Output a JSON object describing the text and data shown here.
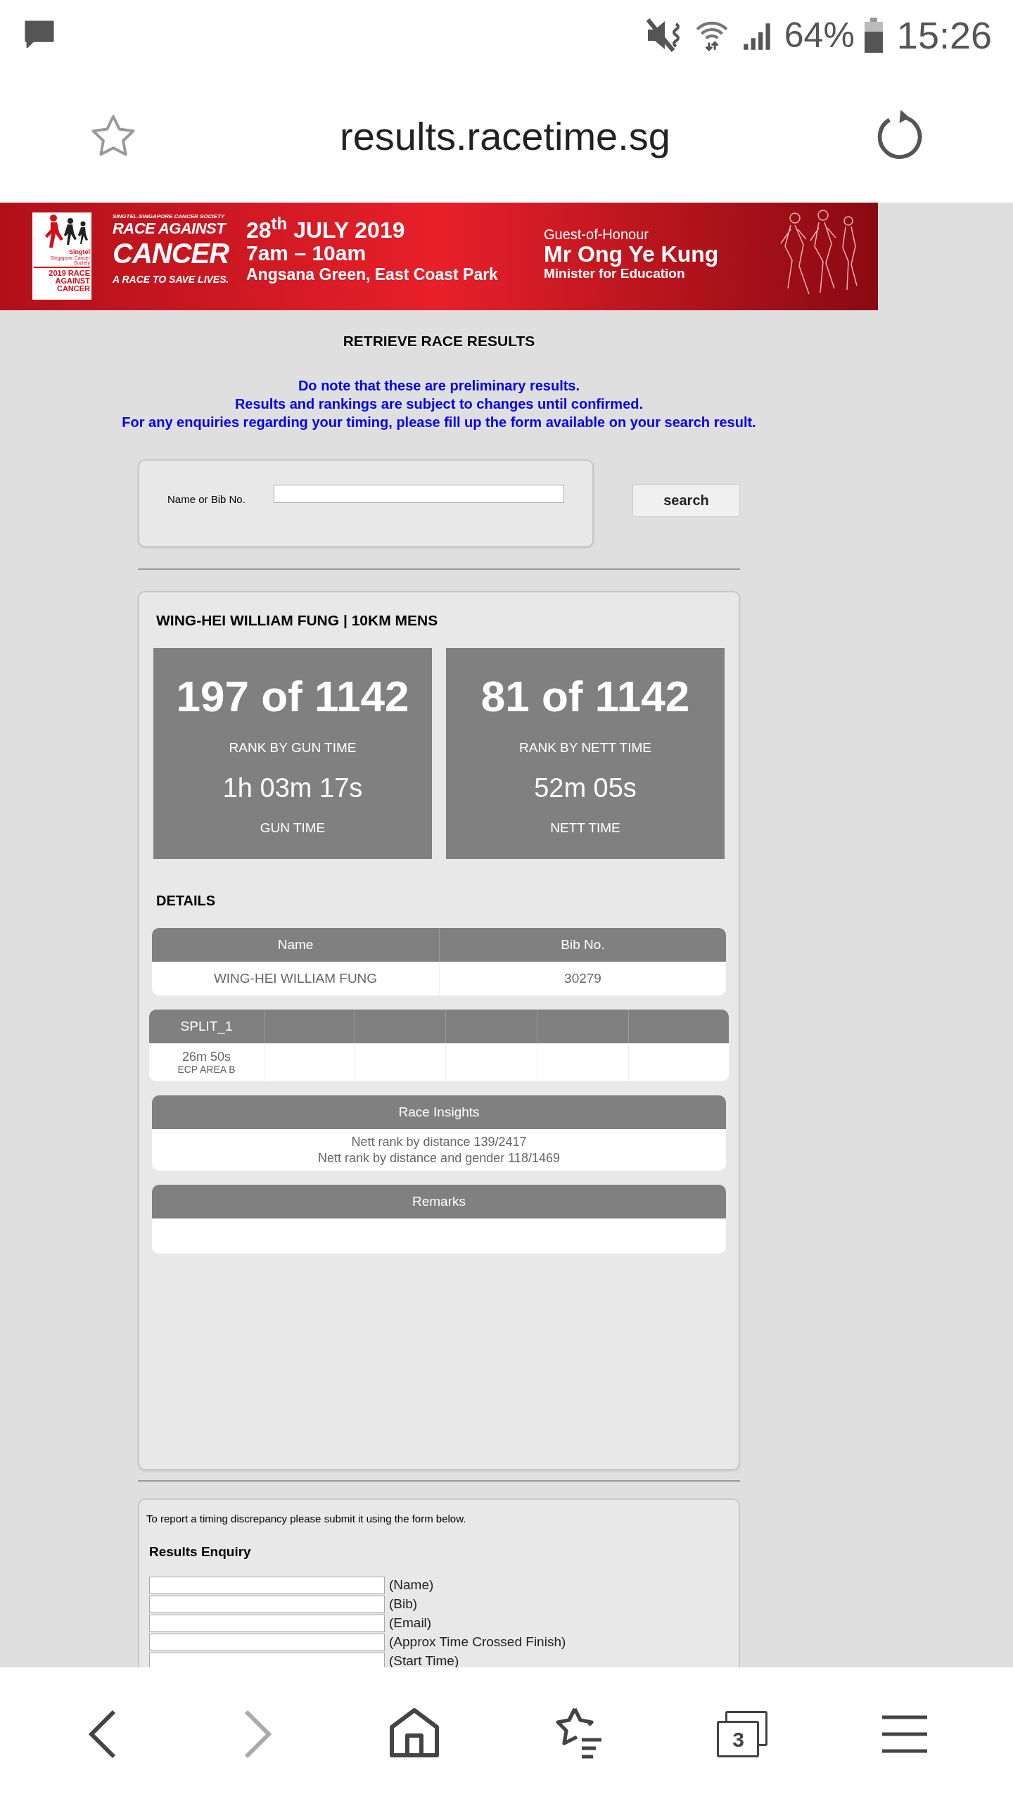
{
  "status_bar": {
    "battery": "64%",
    "time": "15:26"
  },
  "browser": {
    "url": "results.racetime.sg"
  },
  "banner": {
    "logo_brand": "Singtel",
    "logo_org": "Singapore Cancer Society",
    "logo_title": "2019 RACE AGAINST CANCER",
    "org": "SINGTEL-SINGAPORE CANCER SOCIETY",
    "title_1": "RACE AGAINST",
    "title_2": "CANCER",
    "tagline": "A RACE TO SAVE LIVES.",
    "date": "28$^{th}$ JULY 2019",
    "hours": "7am – 10am",
    "venue": "Angsana Green, East Coast Park",
    "guest_label": "Guest-of-Honour",
    "guest_name": "Mr Ong Ye Kung",
    "guest_role": "Minister for Education"
  },
  "heading": "RETRIEVE RACE RESULTS",
  "notices": [
    "Do note that these are preliminary results.",
    "Results and rankings are subject to changes until confirmed.",
    "For any enquiries regarding your timing, please fill up the form available on your search result."
  ],
  "search": {
    "label": "Name or Bib No.",
    "button": "search"
  },
  "result": {
    "title": "WING-HEI WILLIAM FUNG | 10KM MENS",
    "stats": [
      {
        "rank": "197 of 1142",
        "rank_label": "RANK BY GUN TIME",
        "time": "1h 03m 17s",
        "time_label": "GUN TIME"
      },
      {
        "rank": "81 of 1142",
        "rank_label": "RANK BY NETT TIME",
        "time": "52m 05s",
        "time_label": "NETT TIME"
      }
    ],
    "details_heading": "DETAILS",
    "details_table": {
      "columns": [
        "Name",
        "Bib No."
      ],
      "rows": [
        [
          "WING-HEI WILLIAM FUNG",
          "30279"
        ]
      ]
    },
    "splits": [
      {
        "name": "SPLIT_1",
        "time": "26m 50s",
        "location": "ECP AREA B"
      }
    ],
    "insights": {
      "title": "Race Insights",
      "lines": [
        "Nett rank by distance 139/2417",
        "Nett rank by distance and gender 118/1469"
      ]
    },
    "remarks": {
      "title": "Remarks"
    }
  },
  "enquiry": {
    "intro": "To report a timing discrepancy please submit it using the form below.",
    "title": "Results Enquiry",
    "fields": [
      "(Name)",
      "(Bib)",
      "(Email)",
      "(Approx Time Crossed Finish)",
      "(Start Time)"
    ]
  },
  "nav_bar": [
    {
      "kind": "back",
      "disabled": false
    },
    {
      "kind": "forward",
      "disabled": true
    },
    {
      "kind": "home",
      "disabled": false
    },
    {
      "kind": "bookmarks",
      "disabled": false
    },
    {
      "kind": "tabs",
      "disabled": false,
      "count": "3"
    },
    {
      "kind": "menu",
      "disabled": false
    }
  ]
}
